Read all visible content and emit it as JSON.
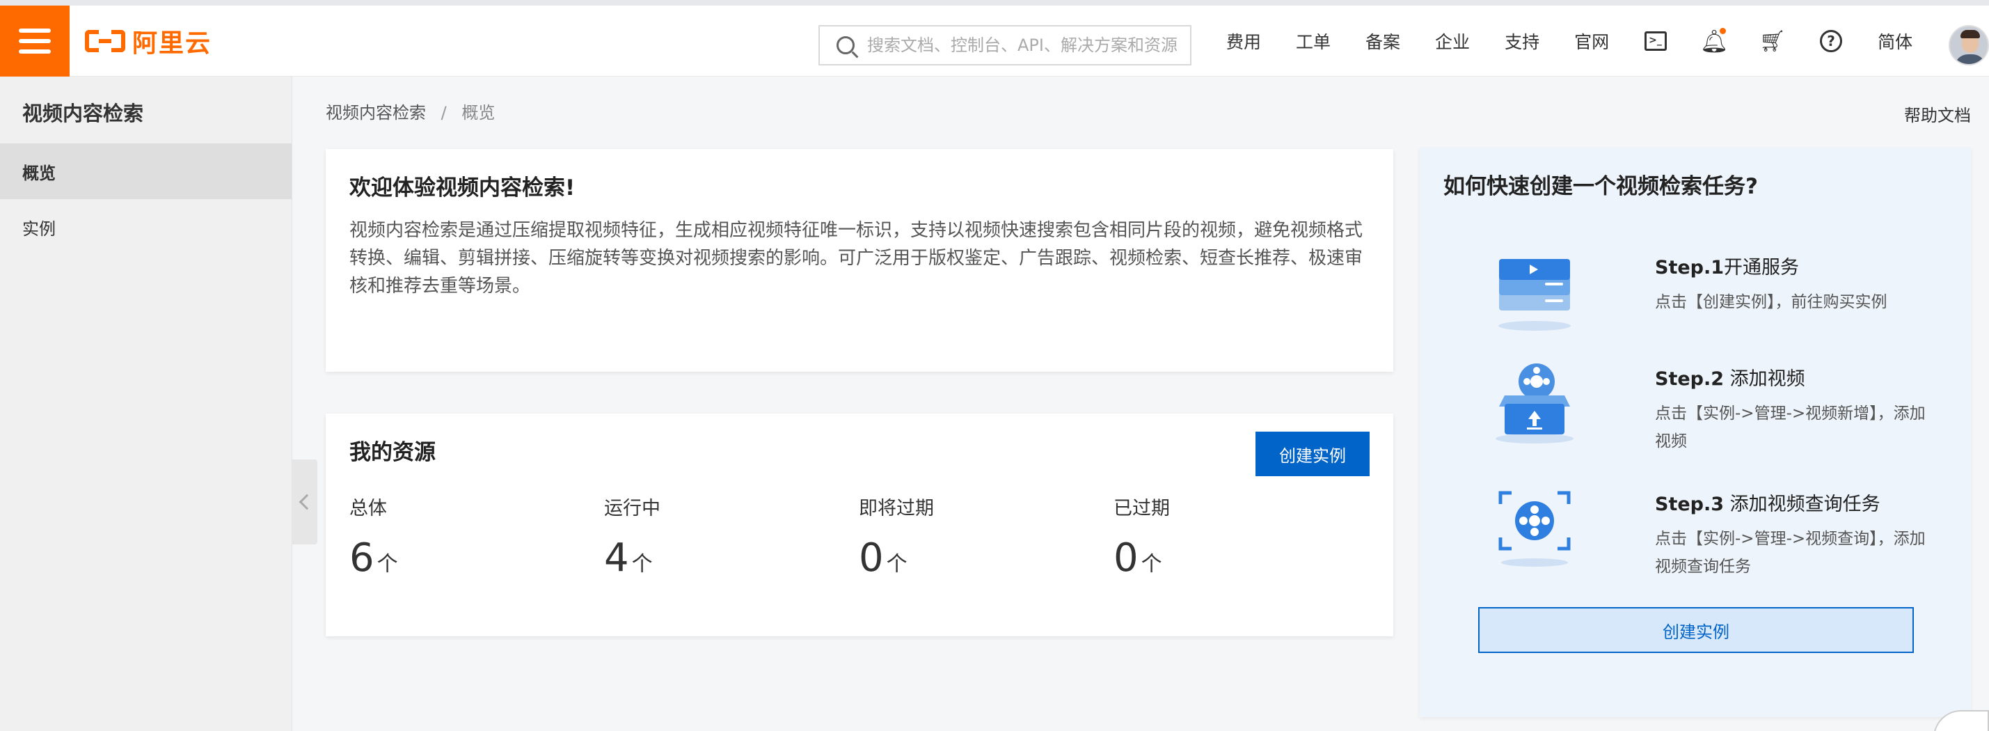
{
  "header": {
    "logo_text": "阿里云",
    "search_placeholder": "搜索文档、控制台、API、解决方案和资源",
    "nav": [
      "费用",
      "工单",
      "备案",
      "企业",
      "支持",
      "官网"
    ],
    "terminal_glyph": ">_",
    "language": "简体",
    "icons": [
      "menu-icon",
      "terminal-icon",
      "bell-icon",
      "cart-icon",
      "help-icon"
    ],
    "accent_color": "#ff6a00"
  },
  "sidebar": {
    "title": "视频内容检索",
    "items": [
      {
        "label": "概览",
        "active": true
      },
      {
        "label": "实例",
        "active": false
      }
    ]
  },
  "breadcrumb": {
    "root": "视频内容检索",
    "separator": "/",
    "current": "概览"
  },
  "help_doc": "帮助文档",
  "welcome": {
    "title": "欢迎体验视频内容检索!",
    "body": "视频内容检索是通过压缩提取视频特征，生成相应视频特征唯一标识，支持以视频快速搜索包含相同片段的视频，避免视频格式转换、编辑、剪辑拼接、压缩旋转等变换对视频搜索的影响。可广泛用于版权鉴定、广告跟踪、视频检索、短查长推荐、极速审核和推荐去重等场景。"
  },
  "resources": {
    "title": "我的资源",
    "create_button": "创建实例",
    "unit": "个",
    "stats": [
      {
        "label": "总体",
        "value": "6"
      },
      {
        "label": "运行中",
        "value": "4"
      },
      {
        "label": "即将过期",
        "value": "0"
      },
      {
        "label": "已过期",
        "value": "0"
      }
    ],
    "button_color": "#0064c8"
  },
  "guide": {
    "title": "如何快速创建一个视频检索任务?",
    "steps": [
      {
        "num": "Step.1",
        "title": "开通服务",
        "desc": "点击【创建实例】，前往购买实例"
      },
      {
        "num": "Step.2",
        "title": " 添加视频",
        "desc": "点击【实例->管理->视频新增】，添加视频"
      },
      {
        "num": "Step.3",
        "title": " 添加视频查询任务",
        "desc": "点击【实例->管理->视频查询】，添加视频查询任务"
      }
    ],
    "create_button": "创建实例"
  }
}
